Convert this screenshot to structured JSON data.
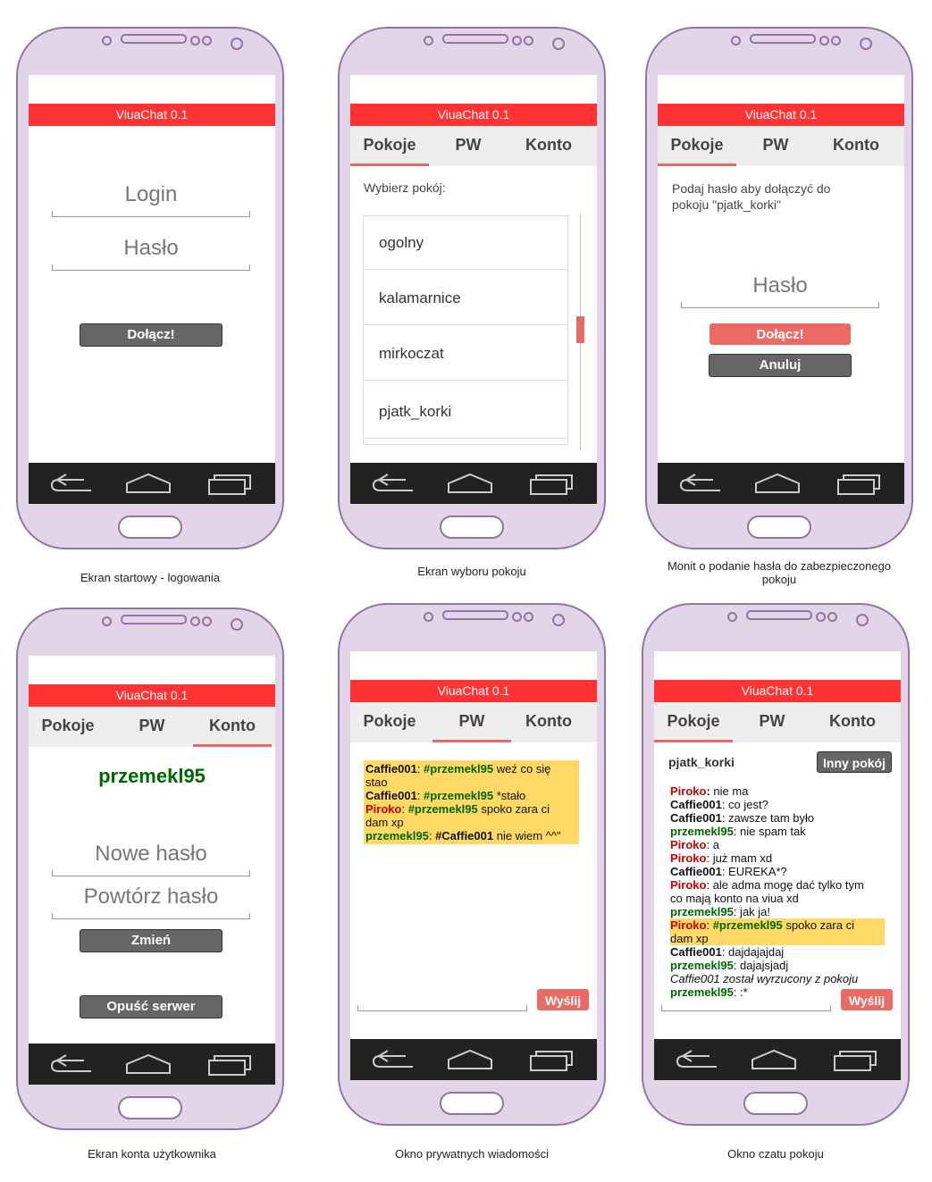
{
  "app_title": "ViuaChat 0.1",
  "tabs": [
    "Pokoje",
    "PW",
    "Konto"
  ],
  "captions": {
    "login": "Ekran startowy - logowania",
    "rooms": "Ekran wyboru pokoju",
    "password_prompt_line1": "Monit o podanie hasła do zabezpieczonego",
    "password_prompt_line2": "pokoju",
    "account": "Ekran konta użytkownika",
    "pm": "Okno prywatnych wiadomości",
    "room_chat": "Okno czatu pokoju"
  },
  "login_screen": {
    "login_placeholder": "Login",
    "password_placeholder": "Hasło",
    "join_label": "Dołącz!"
  },
  "rooms_screen": {
    "prompt": "Wybierz pokój:",
    "rooms": [
      "ogolny",
      "kalamarnice",
      "mirkoczat",
      "pjatk_korki"
    ]
  },
  "password_screen": {
    "prompt_line1": "Podaj hasło aby dołączyć do",
    "prompt_line2": "pokoju \"pjatk_korki\"",
    "password_placeholder": "Hasło",
    "join_label": "Dołącz!",
    "cancel_label": "Anuluj"
  },
  "account_screen": {
    "username": "przemekl95",
    "new_password_placeholder": "Nowe hasło",
    "repeat_password_placeholder": "Powtórz hasło",
    "change_label": "Zmień",
    "leave_label": "Opuść serwer"
  },
  "pm_screen": {
    "send_label": "Wyślij",
    "messages": [
      {
        "from": "Caffie001",
        "sep": ": ",
        "mention": "#przemekl95",
        "text": " weź co się",
        "cont": "stao"
      },
      {
        "from": "Caffie001",
        "sep": ": ",
        "mention": "#przemekl95",
        "text": " *stało",
        "cont": ""
      },
      {
        "from": "Piroko",
        "sep": ": ",
        "mention": "#przemekl95",
        "text": " spoko zara ci",
        "cont": "dam xp"
      },
      {
        "from": "przemekl95",
        "sep": ": ",
        "mention": "#Caffie001",
        "text": " nie wiem ^^\"",
        "cont": ""
      }
    ]
  },
  "room_chat_screen": {
    "room_name": "pjatk_korki",
    "other_room_label": "Inny pokój",
    "send_label": "Wyślij",
    "lines": [
      {
        "from": "Piroko",
        "text": " nie ma"
      },
      {
        "from": "Caffie001",
        "text": ": co jest?"
      },
      {
        "from": "Caffie001",
        "text": ": zawsze tam było"
      },
      {
        "from": "przemekl95",
        "text": ": nie spam tak"
      },
      {
        "from": "Piroko",
        "text": ": a"
      },
      {
        "from": "Piroko",
        "text": ": już mam xd"
      },
      {
        "from": "Caffie001",
        "text": ": EUREKA*?"
      },
      {
        "from": "Piroko",
        "text": ": ale adma mogę dać tylko tym"
      },
      {
        "from": "",
        "text": "co mają konto na viua xd"
      },
      {
        "from": "przemekl95",
        "text": ": jak ja!"
      },
      {
        "from": "Piroko",
        "text": ": ",
        "mention": "#przemekl95",
        "after": " spoko zara ci"
      },
      {
        "from": "",
        "text": "dam xp"
      },
      {
        "from": "Caffie001",
        "text": ": dajdajajdaj"
      },
      {
        "from": "przemekl95",
        "text": ": dajajsjadj"
      },
      {
        "from": "",
        "text": "Caffie001 został wyrzucony z pokoju"
      },
      {
        "from": "przemekl95",
        "text": ": :*"
      }
    ]
  },
  "colors": {
    "accent": "#ff3333",
    "phone_body": "#e1d5e7",
    "highlight": "#ffd966"
  }
}
